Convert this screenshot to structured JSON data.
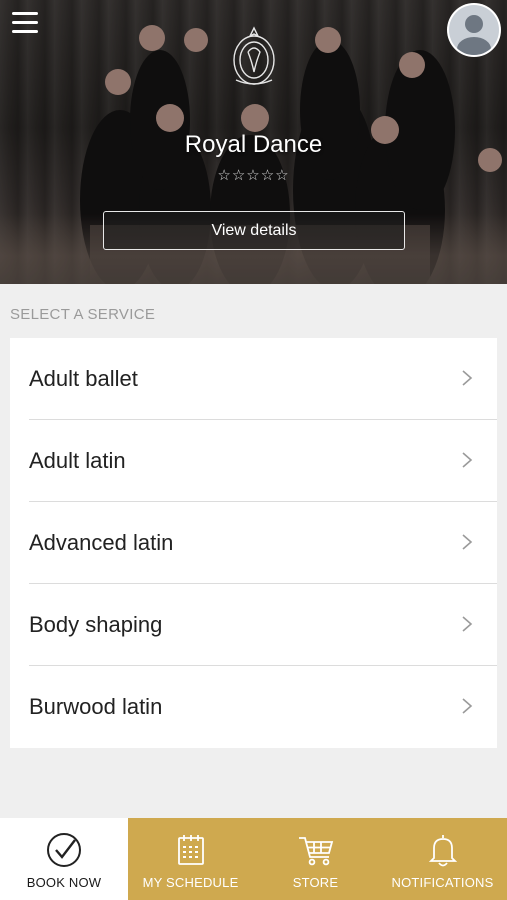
{
  "header": {
    "menu_icon": "hamburger-menu-icon",
    "avatar_icon": "user-avatar-icon",
    "logo_icon": "royal-dance-crest-logo",
    "studio_name": "Royal Dance",
    "rating": "☆☆☆☆☆",
    "rating_value": 0,
    "rating_max": 5,
    "view_details_label": "View details"
  },
  "services": {
    "section_label": "SELECT A SERVICE",
    "items": [
      {
        "label": "Adult ballet"
      },
      {
        "label": "Adult latin"
      },
      {
        "label": "Advanced latin"
      },
      {
        "label": "Body shaping"
      },
      {
        "label": "Burwood latin"
      }
    ]
  },
  "tabbar": {
    "tabs": [
      {
        "label": "BOOK NOW",
        "icon": "check-circle-icon",
        "active": true
      },
      {
        "label": "MY SCHEDULE",
        "icon": "calendar-icon",
        "active": false
      },
      {
        "label": "STORE",
        "icon": "cart-icon",
        "active": false
      },
      {
        "label": "NOTIFICATIONS",
        "icon": "bell-icon",
        "active": false
      }
    ]
  },
  "colors": {
    "accent_gold": "#cfa94f",
    "background": "#efefef",
    "list_bg": "#ffffff",
    "text": "#222222"
  }
}
